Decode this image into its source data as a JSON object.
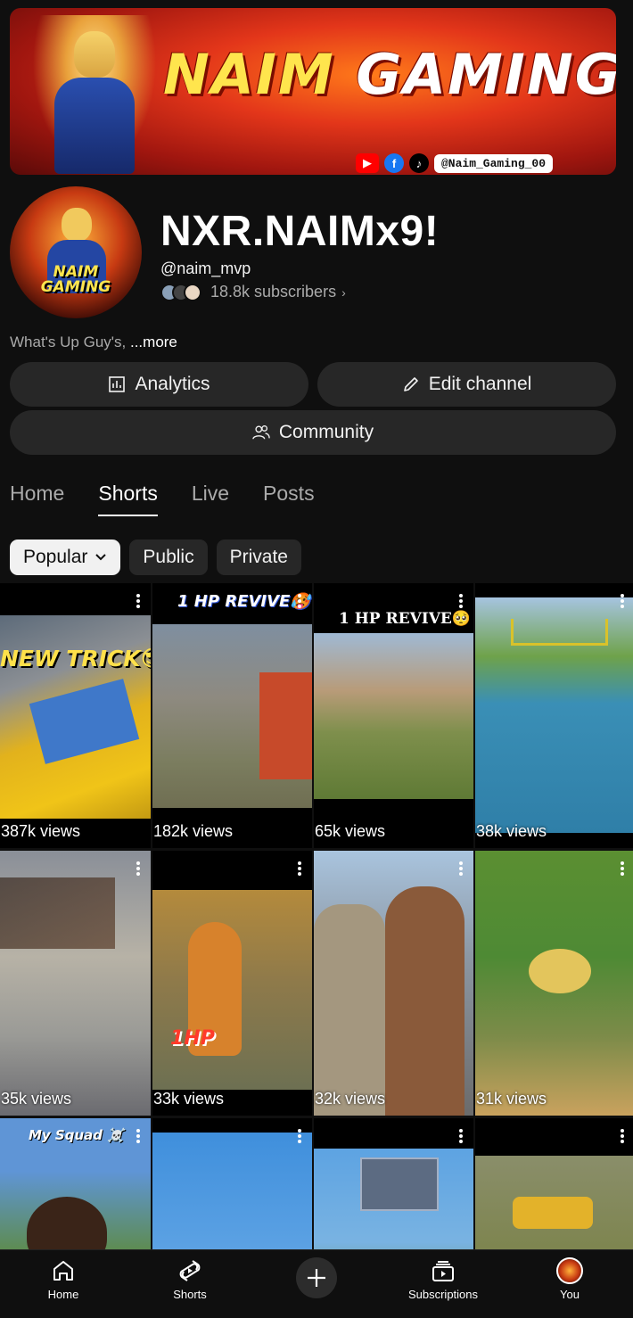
{
  "banner": {
    "title_part1": "NAIM",
    "title_part2": "GAMING",
    "social_handle": "@Naim_Gaming_00",
    "socials": [
      "youtube-icon",
      "facebook-icon",
      "tiktok-icon"
    ]
  },
  "avatar": {
    "text": "NAIM GAMING"
  },
  "channel": {
    "name": "NXR.NAIMx9!",
    "handle": "@naim_mvp",
    "subscribers": "18.8k subscribers",
    "description": "What's Up Guy's,",
    "more": "...more"
  },
  "buttons": {
    "analytics": "Analytics",
    "edit_channel": "Edit channel",
    "community": "Community"
  },
  "tabs": [
    {
      "label": "Home",
      "active": false
    },
    {
      "label": "Shorts",
      "active": true
    },
    {
      "label": "Live",
      "active": false
    },
    {
      "label": "Posts",
      "active": false
    }
  ],
  "chips": [
    {
      "label": "Popular",
      "active": true
    },
    {
      "label": "Public",
      "active": false
    },
    {
      "label": "Private",
      "active": false
    }
  ],
  "shorts": [
    {
      "views": "387k views",
      "overlay": "NEW TRICK😎"
    },
    {
      "views": "182k views",
      "overlay": "1 HP REVIVE🥵"
    },
    {
      "views": "65k views",
      "overlay": "1 HP REVIVE🥺"
    },
    {
      "views": "38k views",
      "overlay": ""
    },
    {
      "views": "35k views",
      "overlay": ""
    },
    {
      "views": "33k views",
      "overlay": "1HP"
    },
    {
      "views": "32k views",
      "overlay": ""
    },
    {
      "views": "31k views",
      "overlay": ""
    },
    {
      "views": "",
      "overlay": "My Squad ☠️"
    },
    {
      "views": "",
      "overlay": ""
    },
    {
      "views": "",
      "overlay": ""
    },
    {
      "views": "",
      "overlay": ""
    }
  ],
  "nav": {
    "home": "Home",
    "shorts": "Shorts",
    "subscriptions": "Subscriptions",
    "you": "You"
  },
  "colors": {
    "background": "#0f0f0f",
    "button_bg": "#272727",
    "text_secondary": "#aaaaaa",
    "banner_accent": "#ffe54d"
  }
}
